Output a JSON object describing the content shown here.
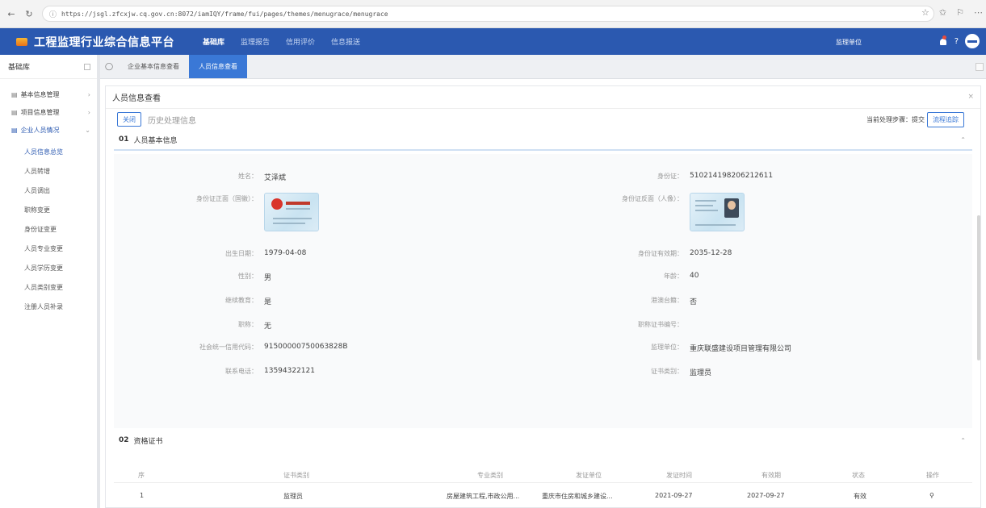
{
  "browser": {
    "url": "https://jsgl.zfcxjw.cq.gov.cn:8072/iamIQY/frame/fui/pages/themes/menugrace/menugrace"
  },
  "header": {
    "title": "工程监理行业综合信息平台",
    "nav": [
      "基础库",
      "监理报告",
      "信用评价",
      "信息报送"
    ],
    "unit": "监理单位",
    "help": "?"
  },
  "sidebar": {
    "title": "基础库",
    "groups": [
      {
        "icon": "▤",
        "label": "基本信息管理",
        "arrow": "›"
      },
      {
        "icon": "▤",
        "label": "项目信息管理",
        "arrow": "›"
      },
      {
        "icon": "▤",
        "label": "企业人员情况",
        "arrow": "⌄"
      }
    ],
    "items": [
      "人员信息总览",
      "人员转增",
      "人员调出",
      "职称变更",
      "身份证变更",
      "人员专业变更",
      "人员学历变更",
      "人员类别变更",
      "注册人员补录"
    ],
    "active_index": 0
  },
  "tabs": {
    "home": "◯",
    "items": [
      "企业基本信息查看",
      "人员信息查看"
    ],
    "active_index": 1
  },
  "card": {
    "title": "人员信息查看",
    "close": "×",
    "toolbar": {
      "close_label": "关闭",
      "history_label": "历史处理信息",
      "next_step": "当前处理步骤：提交",
      "flow_label": "流程追踪"
    }
  },
  "section1": {
    "num": "01",
    "title": "人员基本信息",
    "caret": "⌃",
    "rows": [
      {
        "l_label": "姓名：",
        "l_value": "艾泽斌",
        "r_label": "身份证：",
        "r_value": "510214198206212611"
      },
      {
        "l_label": "身份证正面（国徽）：",
        "l_value": "",
        "r_label": "身份证反面（人像）：",
        "r_value": ""
      },
      {
        "l_label": "出生日期：",
        "l_value": "1979-04-08",
        "r_label": "身份证有效期：",
        "r_value": "2035-12-28"
      },
      {
        "l_label": "性别：",
        "l_value": "男",
        "r_label": "年龄：",
        "r_value": "40"
      },
      {
        "l_label": "继续教育：",
        "l_value": "是",
        "r_label": "港澳台籍：",
        "r_value": "否"
      },
      {
        "l_label": "职称：",
        "l_value": "无",
        "r_label": "职称证书编号：",
        "r_value": ""
      },
      {
        "l_label": "社会统一信用代码：",
        "l_value": "91500000750063828B",
        "r_label": "监理单位：",
        "r_value": "重庆联盛建设项目管理有限公司"
      },
      {
        "l_label": "联系电话：",
        "l_value": "13594322121",
        "r_label": "证书类别：",
        "r_value": "监理员"
      }
    ]
  },
  "section2": {
    "num": "02",
    "title": "资格证书",
    "caret": "⌃",
    "columns": [
      "序",
      "证书类别",
      "专业类别",
      "发证单位",
      "发证时间",
      "有效期",
      "状态",
      "操作"
    ],
    "rows": [
      [
        "1",
        "监理员",
        "房屋建筑工程,市政公用...",
        "重庆市住房和城乡建设...",
        "2021-09-27",
        "2027-09-27",
        "有效",
        "⚲"
      ]
    ]
  }
}
